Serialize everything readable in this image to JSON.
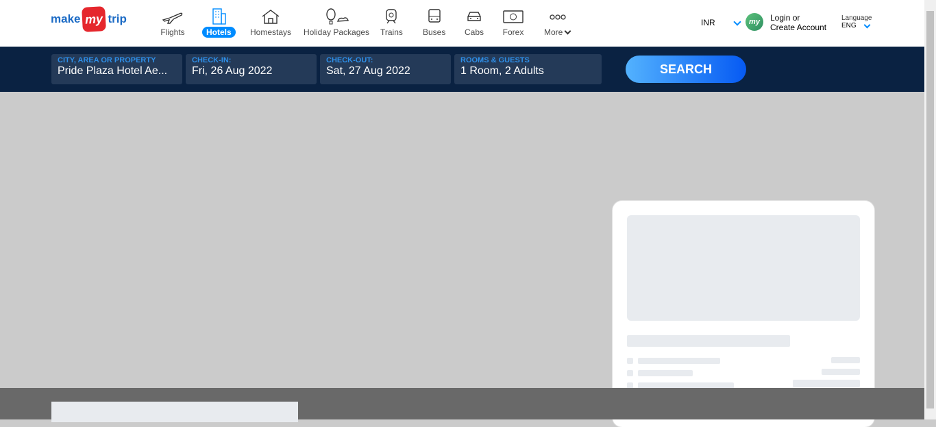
{
  "header": {
    "logo": {
      "part1": "make",
      "part2": "my",
      "part3": "trip"
    },
    "nav": [
      {
        "label": "Flights",
        "icon": "plane-icon"
      },
      {
        "label": "Hotels",
        "icon": "hotel-icon",
        "active": true
      },
      {
        "label": "Homestays",
        "icon": "home-icon"
      },
      {
        "label": "Holiday Packages",
        "icon": "balloon-icon"
      },
      {
        "label": "Trains",
        "icon": "train-icon"
      },
      {
        "label": "Buses",
        "icon": "bus-icon"
      },
      {
        "label": "Cabs",
        "icon": "cab-icon"
      },
      {
        "label": "Forex",
        "icon": "forex-icon"
      },
      {
        "label": "More",
        "icon": "more-icon"
      }
    ],
    "currency": "INR",
    "avatar_text": "my",
    "login_line1": "Login or",
    "login_line2": "Create Account",
    "language_title": "Language",
    "language_value": "ENG"
  },
  "search": {
    "city": {
      "label": "CITY, AREA OR PROPERTY",
      "value": "Pride Plaza Hotel Ae..."
    },
    "checkin": {
      "label": "CHECK-IN:",
      "value": "Fri, 26 Aug 2022"
    },
    "checkout": {
      "label": "CHECK-OUT:",
      "value": "Sat, 27 Aug 2022"
    },
    "rooms": {
      "label": "ROOMS & GUESTS",
      "value": "1 Room, 2 Adults"
    },
    "button": "SEARCH"
  },
  "colors": {
    "brand_blue": "#008cff",
    "nav_dark": "#0a2242",
    "logo_red": "#e5272d"
  }
}
